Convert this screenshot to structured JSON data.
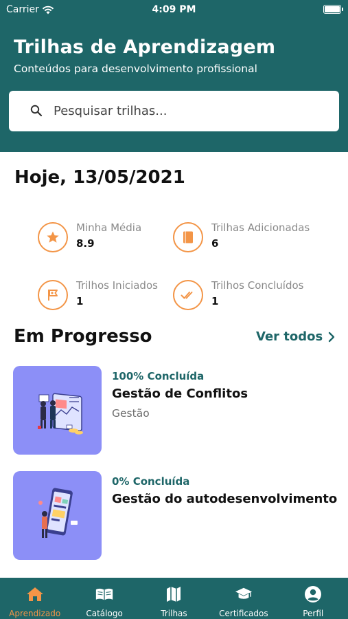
{
  "status_bar": {
    "carrier": "Carrier",
    "time": "4:09 PM"
  },
  "header": {
    "title": "Trilhas de Aprendizagem",
    "subtitle": "Conteúdos para desenvolvimento profissional"
  },
  "search": {
    "placeholder": "Pesquisar trilhas...",
    "icon": "search-icon"
  },
  "date_heading": "Hoje, 13/05/2021",
  "stats": [
    {
      "icon": "star-icon",
      "label": "Minha Média",
      "value": "8.9"
    },
    {
      "icon": "book-icon",
      "label": "Trilhas Adicionadas",
      "value": "6"
    },
    {
      "icon": "flag-icon",
      "label": "Trilhos Iniciados",
      "value": "1"
    },
    {
      "icon": "double-check-icon",
      "label": "Trilhos Concluídos",
      "value": "1"
    }
  ],
  "in_progress": {
    "title": "Em Progresso",
    "see_all": "Ver todos",
    "items": [
      {
        "progress": "100% Concluída",
        "title": "Gestão de Conflitos",
        "category": "Gestão"
      },
      {
        "progress": "0% Concluída",
        "title": "Gestão do autodesenvolvimento",
        "category": ""
      }
    ]
  },
  "tabbar": {
    "tabs": [
      {
        "label": "Aprendizado",
        "icon": "home-icon",
        "active": true
      },
      {
        "label": "Catálogo",
        "icon": "open-book-icon",
        "active": false
      },
      {
        "label": "Trilhas",
        "icon": "map-icon",
        "active": false
      },
      {
        "label": "Certificados",
        "icon": "graduation-cap-icon",
        "active": false
      },
      {
        "label": "Perfil",
        "icon": "user-icon",
        "active": false
      }
    ]
  },
  "colors": {
    "primary": "#1e6668",
    "accent": "#f39547",
    "thumbnail_bg": "#8c8ff7"
  }
}
